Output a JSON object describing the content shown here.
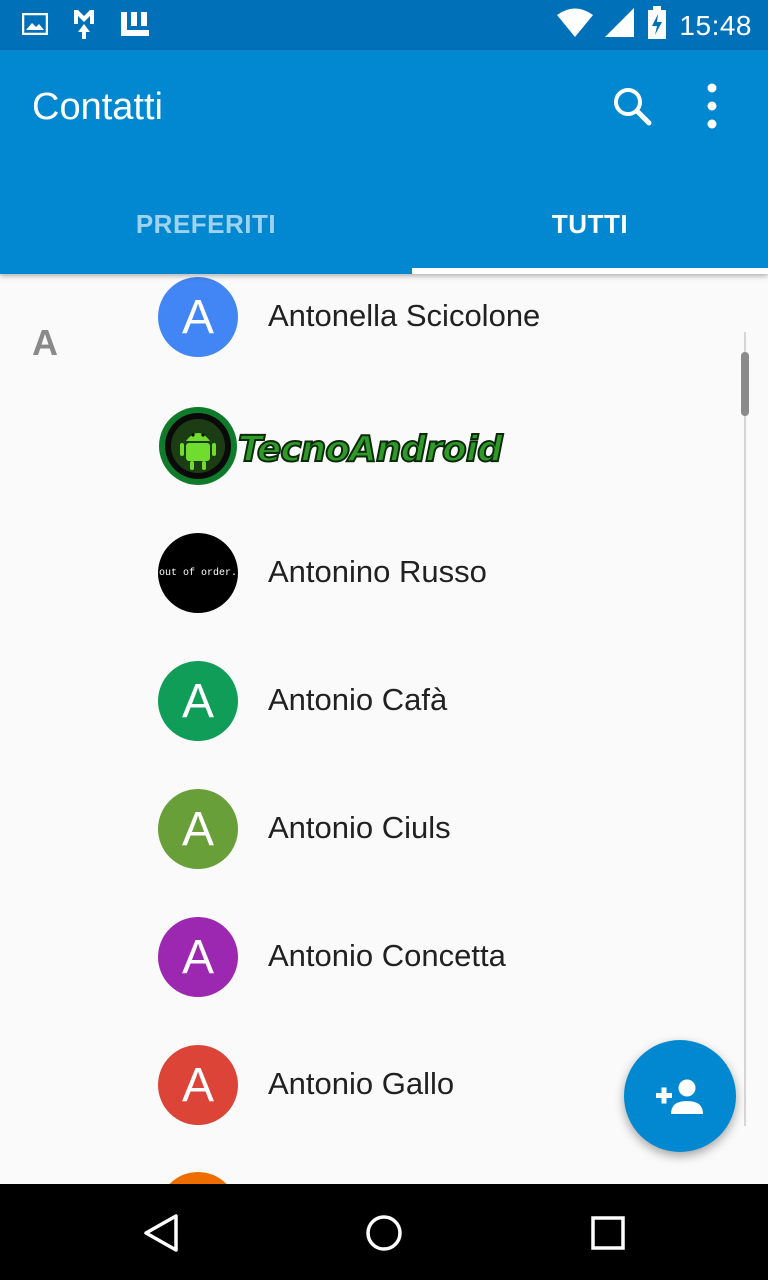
{
  "status_bar": {
    "time": "15:48",
    "left_icons": [
      "image-icon",
      "gmail-icon",
      "apps-icon"
    ],
    "right_icons": [
      "wifi-icon",
      "signal-icon",
      "battery-charging-icon"
    ]
  },
  "app_bar": {
    "title": "Contatti",
    "actions": [
      "search-icon",
      "more-vert-icon"
    ]
  },
  "tabs": [
    {
      "label": "PREFERITI",
      "selected": false
    },
    {
      "label": "TUTTI",
      "selected": true
    }
  ],
  "contacts": {
    "section_letter": "A",
    "items": [
      {
        "name": "Antonella Scicolone",
        "initial": "A",
        "color": "#4285f4"
      },
      {
        "name": "TecnoAndroid",
        "logo": true
      },
      {
        "name": "Antonino Russo",
        "avatar_text": "out of order."
      },
      {
        "name": "Antonio Cafà",
        "initial": "A",
        "color": "#0f9d58"
      },
      {
        "name": "Antonio Ciuls",
        "initial": "A",
        "color": "#689f38"
      },
      {
        "name": "Antonio Concetta",
        "initial": "A",
        "color": "#9c27b0"
      },
      {
        "name": "Antonio Gallo",
        "initial": "A",
        "color": "#db4437"
      }
    ]
  },
  "colors": {
    "status_bar": "#0071b8",
    "app_bar": "#0288d1",
    "fab": "#0288d1"
  },
  "fab": {
    "icon": "person-add-icon"
  },
  "nav_bar": {
    "icons": [
      "back-icon",
      "home-icon",
      "recents-icon"
    ]
  }
}
